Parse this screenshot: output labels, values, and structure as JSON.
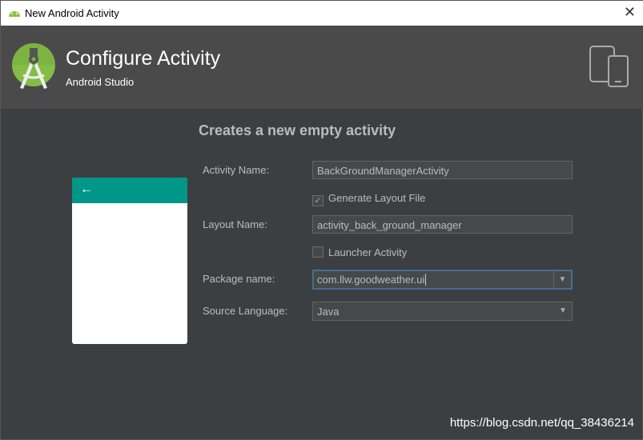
{
  "window": {
    "title": "New Android Activity",
    "close": "✕",
    "icon": "android-icon"
  },
  "header": {
    "title": "Configure Activity",
    "subtitle": "Android Studio",
    "logo": "android-studio-logo",
    "device_icon": "devices-icon",
    "color": "#4a4a4a"
  },
  "main": {
    "heading": "Creates a new empty activity",
    "preview": {
      "back": "←",
      "accent": "#009688"
    },
    "activity_name": {
      "label": "Activity Name:",
      "value": "BackGroundManagerActivity"
    },
    "generate_layout": {
      "label": "Generate Layout File",
      "checked": true,
      "mark": "✓"
    },
    "layout_name": {
      "label": "Layout Name:",
      "value": "activity_back_ground_manager"
    },
    "launcher": {
      "label": "Launcher Activity",
      "checked": false
    },
    "package": {
      "label": "Package name:",
      "value": "com.llw.goodweather.ui"
    },
    "language": {
      "label": "Source Language:",
      "value": "Java"
    },
    "dropdown_arrow": "▼"
  },
  "watermark": "https://blog.csdn.net/qq_38436214"
}
